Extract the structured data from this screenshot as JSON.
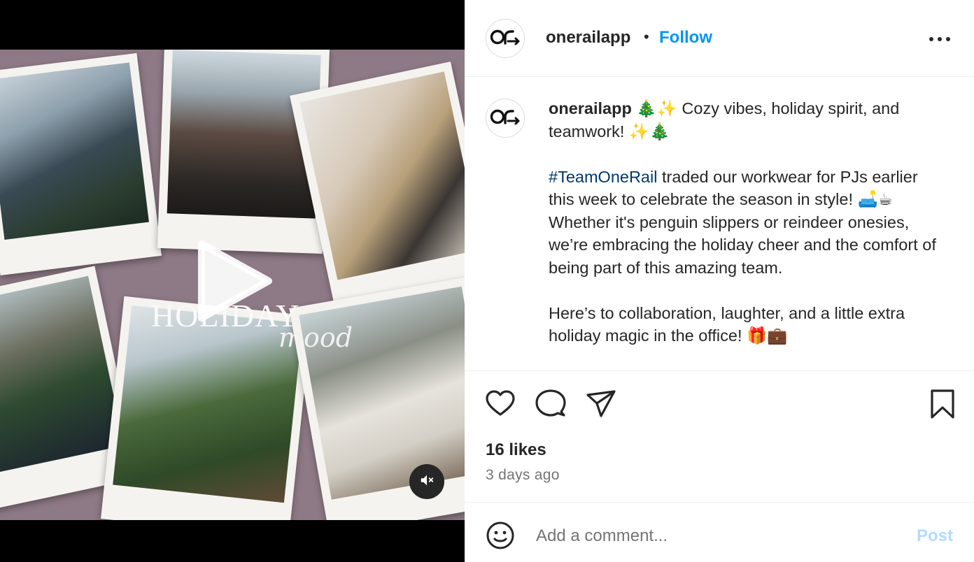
{
  "media": {
    "title_main": "HOLIDAY",
    "title_script": "mood"
  },
  "header": {
    "username": "onerailapp",
    "separator": "•",
    "follow_label": "Follow"
  },
  "caption": {
    "username": "onerailapp",
    "line1": "🎄✨ Cozy vibes, holiday spirit, and teamwork! ✨🎄",
    "hashtag": "#TeamOneRail",
    "para2": " traded our workwear for PJs earlier this week to celebrate the season in style! 🛋️☕ Whether it's penguin slippers or reindeer onesies, we’re embracing the holiday cheer and the comfort of being part of this amazing team.",
    "para3": "Here’s to collaboration, laughter, and a little extra holiday magic in the office! 🎁💼"
  },
  "stats": {
    "likes": "16 likes",
    "time_ago": "3 days ago"
  },
  "comment": {
    "placeholder": "Add a comment...",
    "post_label": "Post"
  },
  "colors": {
    "link_blue": "#0095f6",
    "hashtag_blue": "#00376b",
    "post_disabled": "#b3dbff",
    "collage_background": "#8e7a86"
  },
  "icons": {
    "avatar": "onerail-logo-icon",
    "more": "more-options-icon",
    "like": "heart-icon",
    "comment": "comment-bubble-icon",
    "share": "paper-plane-icon",
    "save": "bookmark-icon",
    "emoji": "smiley-icon",
    "play": "play-icon",
    "mute": "muted-speaker-icon"
  }
}
